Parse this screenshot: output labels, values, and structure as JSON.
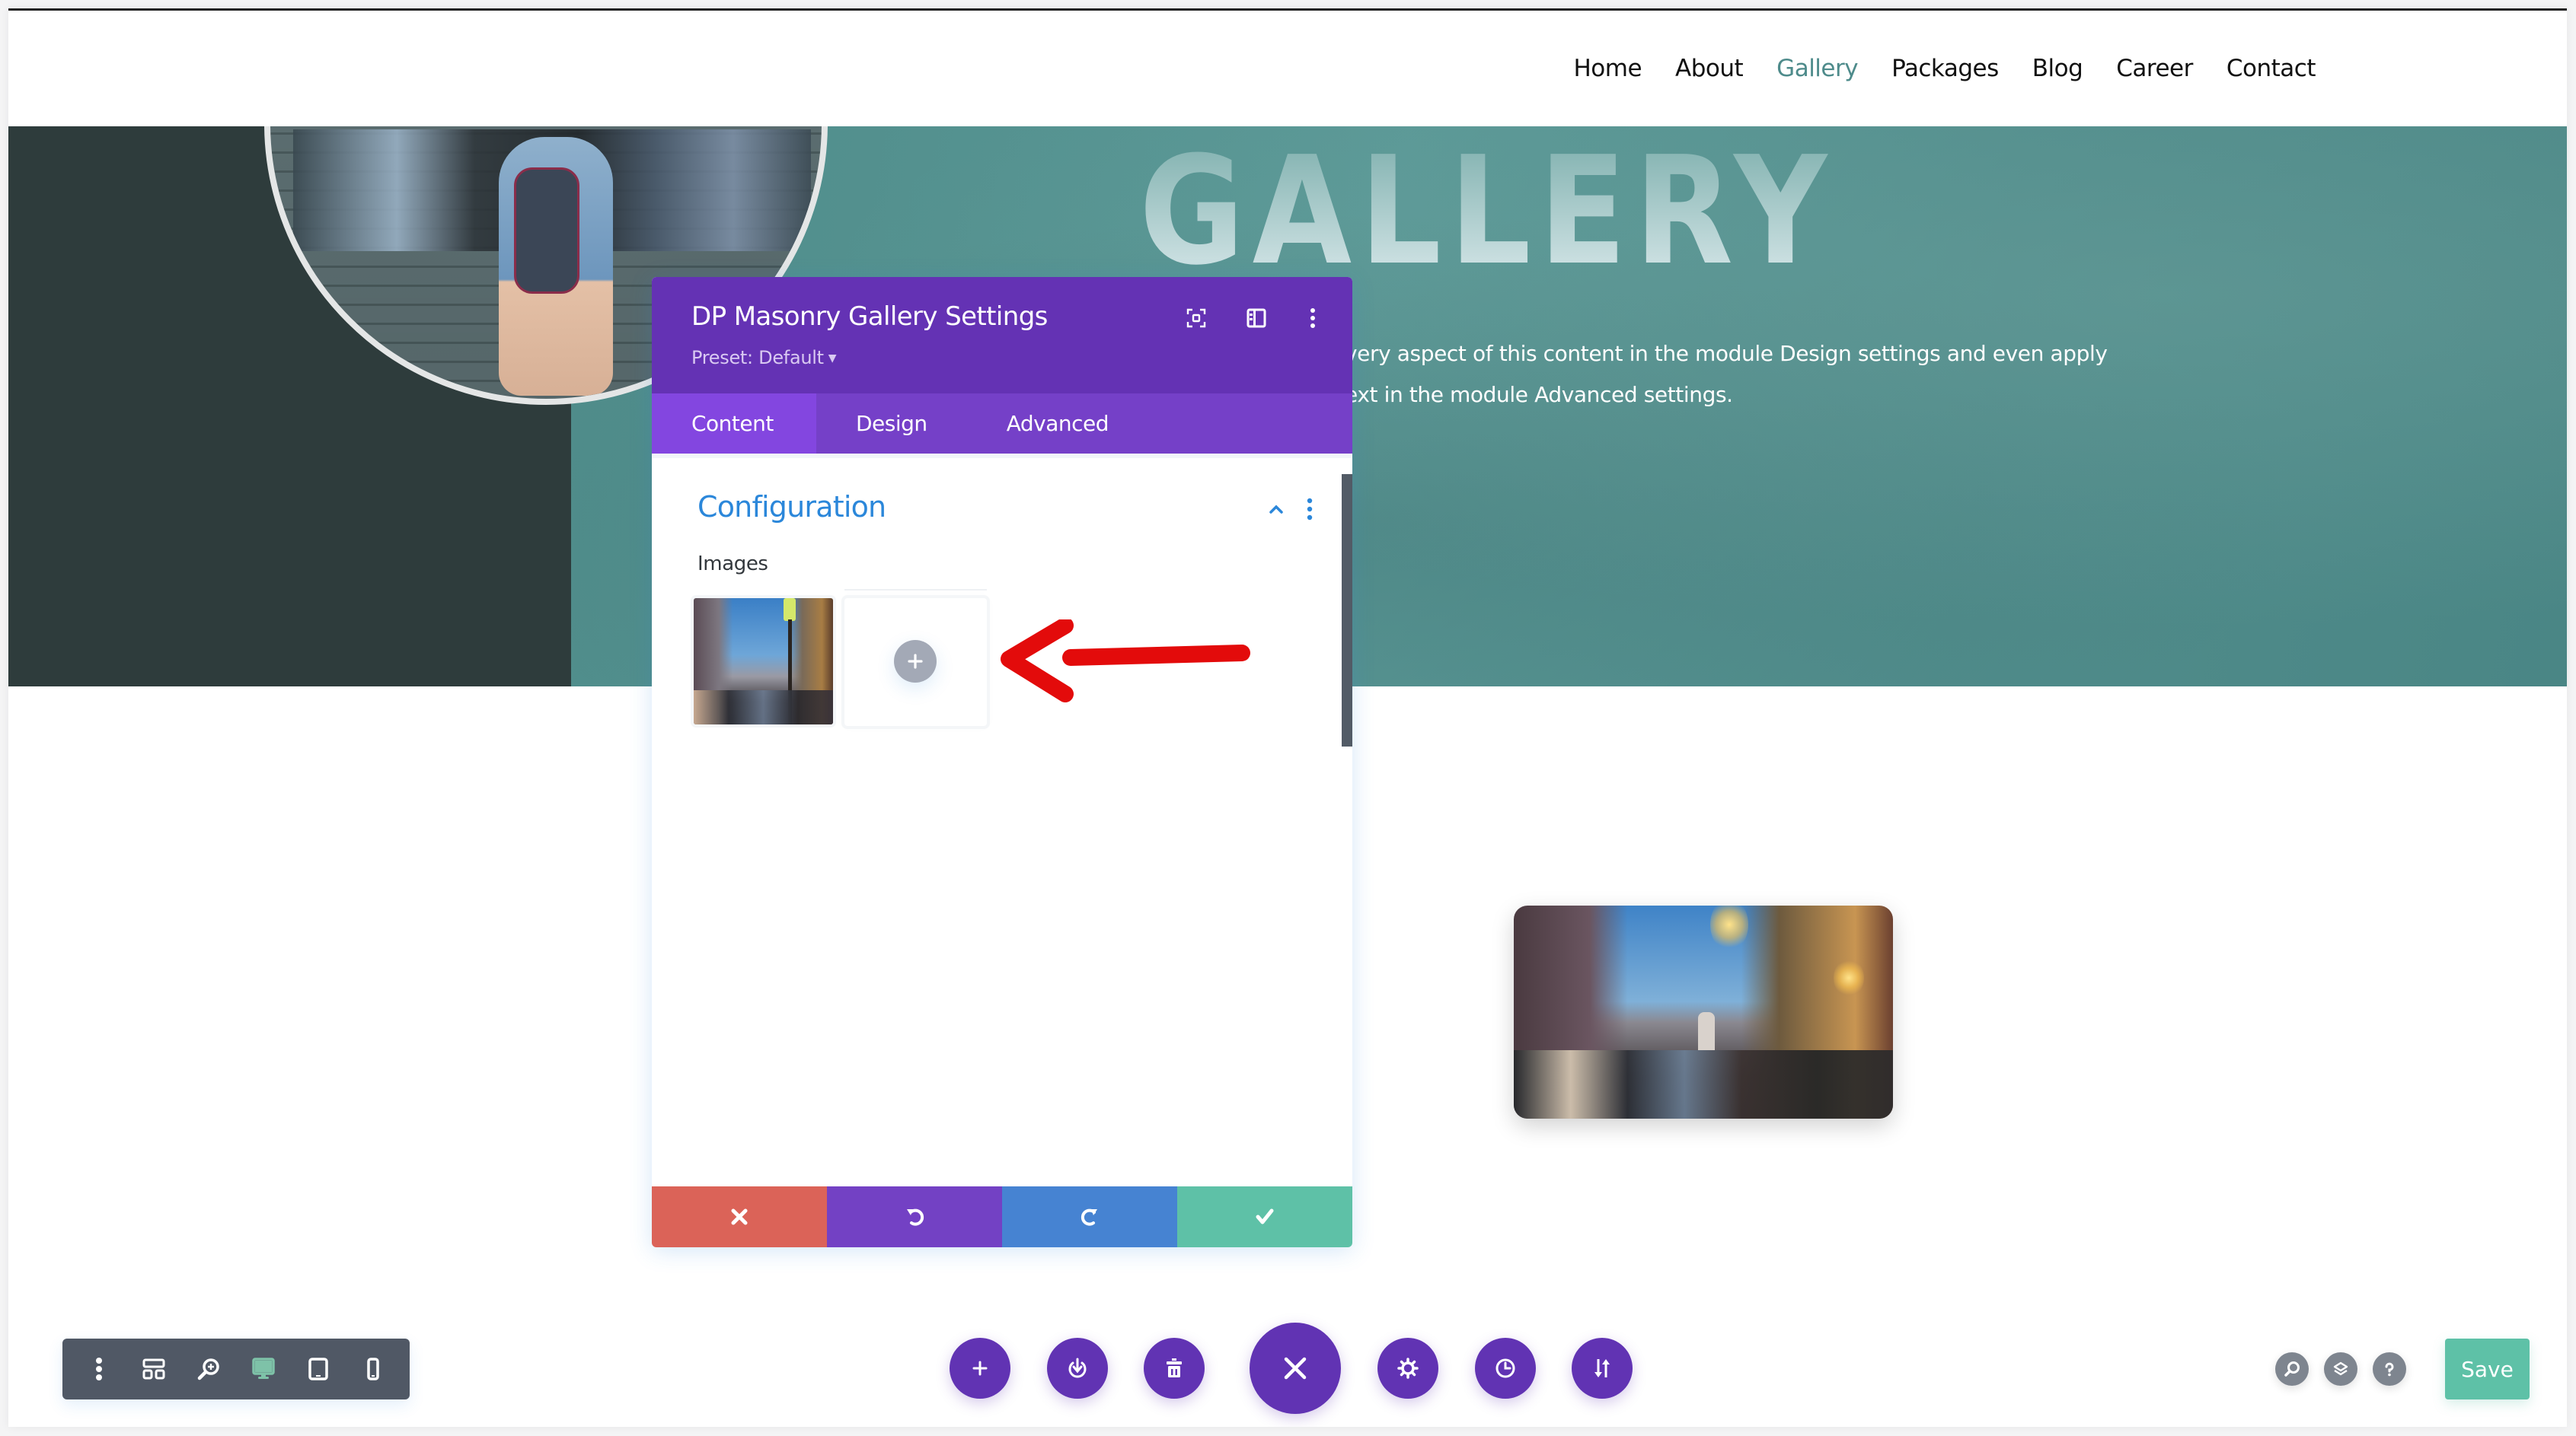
{
  "nav": {
    "items": [
      {
        "label": "Home",
        "active": false
      },
      {
        "label": "About",
        "active": false
      },
      {
        "label": "Gallery",
        "active": true
      },
      {
        "label": "Packages",
        "active": false
      },
      {
        "label": "Blog",
        "active": false
      },
      {
        "label": "Career",
        "active": false
      },
      {
        "label": "Contact",
        "active": false
      }
    ],
    "active_color": "#4e8b8b"
  },
  "hero": {
    "title": "GALLERY",
    "text_line1": "very aspect of this content in the module Design settings and even apply",
    "text_line2": "ext in the module Advanced settings."
  },
  "panel": {
    "title": "DP Masonry Gallery Settings",
    "preset": "Preset: Default",
    "header_icons": [
      "expand-icon",
      "sidebar-layout-icon",
      "more-vertical-icon"
    ],
    "tabs": [
      {
        "label": "Content",
        "active": true
      },
      {
        "label": "Design",
        "active": false
      },
      {
        "label": "Advanced",
        "active": false
      }
    ],
    "section": {
      "title": "Configuration",
      "expanded": true,
      "images_label": "Images",
      "images": [
        {
          "alt": "Street scene thumbnail"
        }
      ],
      "add_image_label": "+"
    },
    "footer": {
      "discard": "discard-icon",
      "undo": "undo-icon",
      "redo": "redo-icon",
      "save": "check-icon"
    },
    "colors": {
      "header": "#6432b4",
      "tabs": "#7540c8",
      "active_tab": "#8346e0",
      "section_title": "#2b87da",
      "discard": "#db6358",
      "undo": "#7341c4",
      "redo": "#4683d2",
      "save": "#5ec1a7"
    }
  },
  "annotation": {
    "type": "arrow",
    "color": "#e00000",
    "points_to": "add-image-button"
  },
  "view_toolbar": {
    "items": [
      {
        "icon": "more-vertical-icon",
        "active": false
      },
      {
        "icon": "wireframe-icon",
        "active": false
      },
      {
        "icon": "zoom-icon",
        "active": false
      },
      {
        "icon": "desktop-icon",
        "active": true
      },
      {
        "icon": "tablet-icon",
        "active": false
      },
      {
        "icon": "phone-icon",
        "active": false
      }
    ],
    "active_color": "#7ec2a8"
  },
  "center_actions": [
    {
      "icon": "plus-icon"
    },
    {
      "icon": "power-icon"
    },
    {
      "icon": "trash-icon"
    },
    {
      "icon": "close-icon"
    },
    {
      "icon": "gear-icon"
    },
    {
      "icon": "history-icon"
    },
    {
      "icon": "sort-icon"
    }
  ],
  "right_actions": {
    "icons": [
      "search-icon",
      "layers-icon",
      "help-icon"
    ],
    "save_label": "Save"
  }
}
